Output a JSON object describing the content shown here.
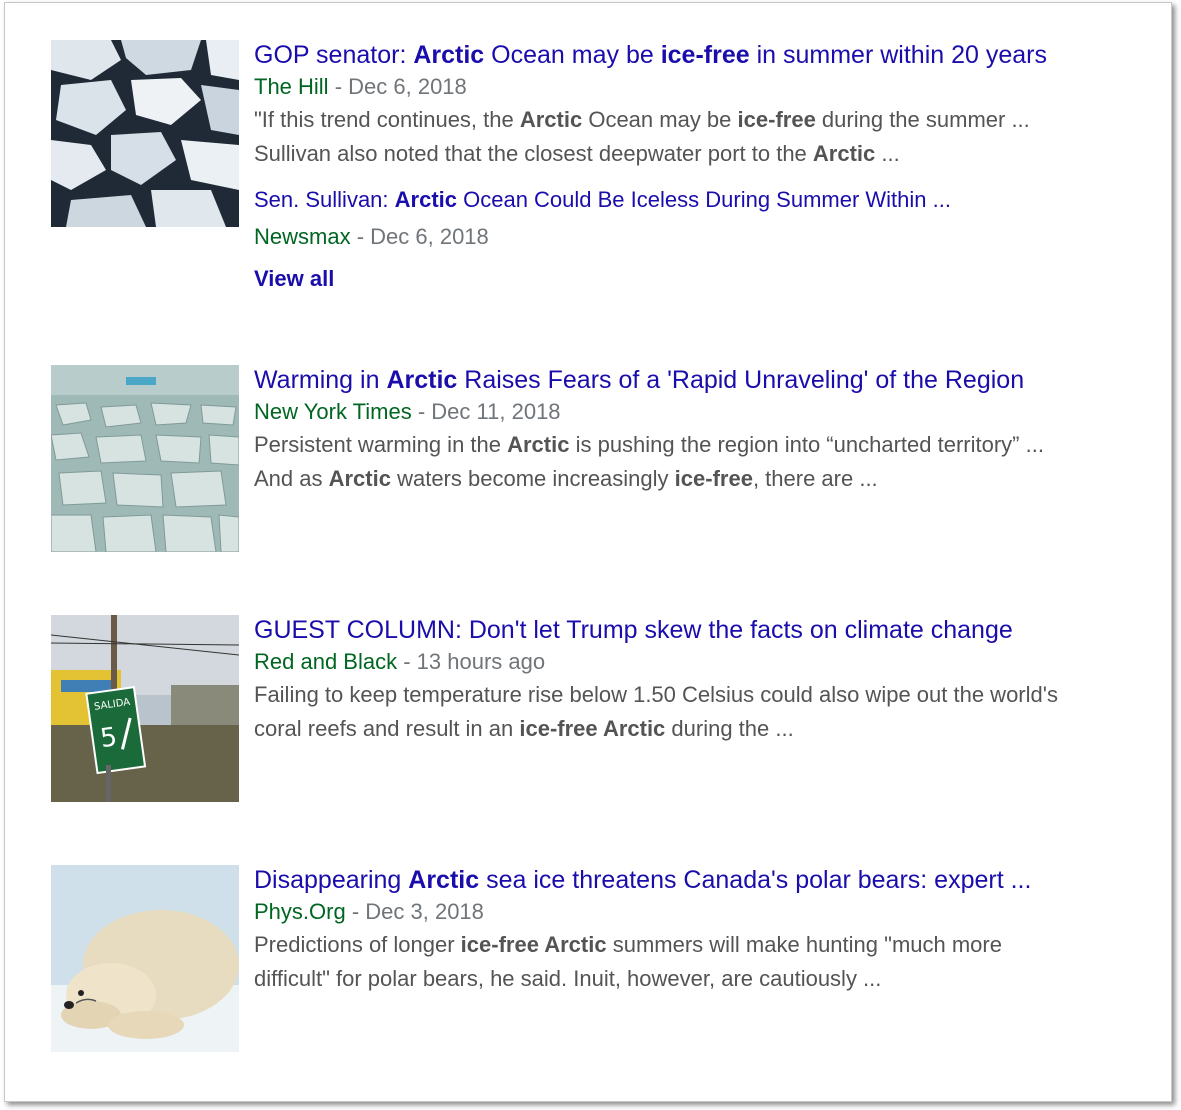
{
  "results": [
    {
      "thumb_icon": "ice-floes-image",
      "title_parts": [
        {
          "t": "GOP senator: ",
          "b": false
        },
        {
          "t": "Arctic",
          "b": true
        },
        {
          "t": " Ocean may be ",
          "b": false
        },
        {
          "t": "ice-free",
          "b": true
        },
        {
          "t": " in summer within 20 years",
          "b": false
        }
      ],
      "source": "The Hill",
      "separator": " - ",
      "date": "Dec 6, 2018",
      "snippet_lines": [
        [
          {
            "t": "\"If this trend continues, the ",
            "b": false
          },
          {
            "t": "Arctic",
            "b": true
          },
          {
            "t": " Ocean may be ",
            "b": false
          },
          {
            "t": "ice-free",
            "b": true
          },
          {
            "t": " during the summer ...",
            "b": false
          }
        ],
        [
          {
            "t": "Sullivan also noted that the closest deepwater port to the ",
            "b": false
          },
          {
            "t": "Arctic",
            "b": true
          },
          {
            "t": " ...",
            "b": false
          }
        ]
      ],
      "related": {
        "title_parts": [
          {
            "t": "Sen. Sullivan: ",
            "b": false
          },
          {
            "t": "Arctic",
            "b": true
          },
          {
            "t": " Ocean Could Be Iceless During Summer Within ...",
            "b": false
          }
        ],
        "source": "Newsmax",
        "separator": " - ",
        "date": "Dec 6, 2018"
      },
      "view_all": "View all"
    },
    {
      "thumb_icon": "arctic-sea-ice-image",
      "title_parts": [
        {
          "t": "Warming in ",
          "b": false
        },
        {
          "t": "Arctic",
          "b": true
        },
        {
          "t": " Raises Fears of a 'Rapid Unraveling' of the Region",
          "b": false
        }
      ],
      "source": "New York Times",
      "separator": " - ",
      "date": "Dec 11, 2018",
      "snippet_lines": [
        [
          {
            "t": "Persistent warming in the ",
            "b": false
          },
          {
            "t": "Arctic",
            "b": true
          },
          {
            "t": " is pushing the region into “uncharted territory” ...",
            "b": false
          }
        ],
        [
          {
            "t": "And as ",
            "b": false
          },
          {
            "t": "Arctic",
            "b": true
          },
          {
            "t": " waters become increasingly ",
            "b": false
          },
          {
            "t": "ice-free",
            "b": true
          },
          {
            "t": ", there are ...",
            "b": false
          }
        ]
      ]
    },
    {
      "thumb_icon": "flooded-street-image",
      "thumb_sign_text": "SALIDA",
      "thumb_sign_number": "5",
      "title_parts": [
        {
          "t": "GUEST COLUMN: Don't let Trump skew the facts on climate change",
          "b": false
        }
      ],
      "source": "Red and Black",
      "separator": " - ",
      "date": "13 hours ago",
      "snippet_lines": [
        [
          {
            "t": "Failing to keep temperature rise below 1.50 Celsius could also wipe out the world's",
            "b": false
          }
        ],
        [
          {
            "t": "coral reefs and result in an ",
            "b": false
          },
          {
            "t": "ice-free Arctic",
            "b": true
          },
          {
            "t": " during the ...",
            "b": false
          }
        ]
      ]
    },
    {
      "thumb_icon": "polar-bear-image",
      "title_parts": [
        {
          "t": "Disappearing ",
          "b": false
        },
        {
          "t": "Arctic",
          "b": true
        },
        {
          "t": " sea ice threatens Canada's polar bears: expert ...",
          "b": false
        }
      ],
      "source": "Phys.Org",
      "separator": " - ",
      "date": "Dec 3, 2018",
      "snippet_lines": [
        [
          {
            "t": "Predictions of longer ",
            "b": false
          },
          {
            "t": "ice-free Arctic",
            "b": true
          },
          {
            "t": " summers will make hunting \"much more",
            "b": false
          }
        ],
        [
          {
            "t": "difficult\" for polar bears, he said. Inuit, however, are cautiously ...",
            "b": false
          }
        ]
      ]
    }
  ]
}
